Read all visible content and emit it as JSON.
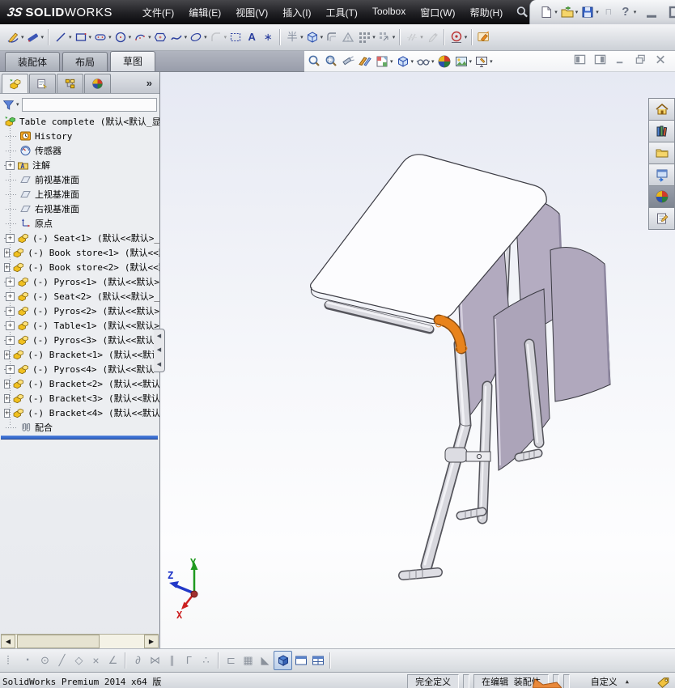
{
  "titlebar": {
    "brand": {
      "mark": "3S",
      "bold": "SOLID",
      "light": "WORKS"
    },
    "menus": [
      "文件(F)",
      "编辑(E)",
      "视图(V)",
      "插入(I)",
      "工具(T)",
      "Toolbox",
      "窗口(W)",
      "帮助(H)"
    ],
    "quick_icons": [
      {
        "name": "new-document",
        "dd": true
      },
      {
        "name": "open-document",
        "dd": true
      },
      {
        "name": "save-document",
        "dd": true
      },
      {
        "name": "rebuild",
        "disabled": true
      },
      {
        "name": "help",
        "dd": true
      }
    ],
    "window_controls": [
      "minimize",
      "maximize",
      "close"
    ]
  },
  "sketch_toolbar": [
    {
      "name": "sketch",
      "dd": true
    },
    {
      "name": "smart-dimension",
      "dd": true
    },
    {
      "sep": true
    },
    {
      "name": "line",
      "dd": true
    },
    {
      "name": "corner-rectangle",
      "dd": true
    },
    {
      "name": "straight-slot",
      "dd": true
    },
    {
      "name": "circle",
      "dd": true
    },
    {
      "name": "centerpoint-arc",
      "dd": true
    },
    {
      "name": "polygon"
    },
    {
      "name": "spline",
      "dd": true
    },
    {
      "name": "ellipse",
      "dd": true
    },
    {
      "name": "sketch-fillet",
      "dd": true,
      "disabled": true
    },
    {
      "name": "selection-box"
    },
    {
      "name": "text"
    },
    {
      "name": "point"
    },
    {
      "sep": true
    },
    {
      "name": "trim-entities",
      "dd": true
    },
    {
      "name": "convert-entities",
      "dd": true
    },
    {
      "name": "offset-entities"
    },
    {
      "name": "mirror-entities"
    },
    {
      "name": "linear-sketch-pattern",
      "dd": true
    },
    {
      "name": "move-entities",
      "dd": true
    },
    {
      "sep": true
    },
    {
      "name": "display-relations",
      "dd": true,
      "disabled": true
    },
    {
      "name": "add-relation",
      "disabled": true
    },
    {
      "sep": true
    },
    {
      "name": "instant2d",
      "dd": true
    },
    {
      "sep": true
    },
    {
      "name": "sketch-tools"
    }
  ],
  "command_tabs": [
    {
      "label": "装配体",
      "active": false
    },
    {
      "label": "布局",
      "active": false
    },
    {
      "label": "草图",
      "active": true
    }
  ],
  "hud_toolbar": [
    {
      "name": "zoom-to-fit"
    },
    {
      "name": "zoom-to-area"
    },
    {
      "name": "previous-view"
    },
    {
      "name": "section-view"
    },
    {
      "name": "view-orientation",
      "dd": true
    },
    {
      "name": "display-style",
      "dd": true
    },
    {
      "name": "hide-show-items",
      "dd": true
    },
    {
      "name": "edit-appearance"
    },
    {
      "name": "apply-scene",
      "dd": true
    },
    {
      "name": "view-settings",
      "dd": true
    }
  ],
  "document_controls": [
    "pane-left",
    "pane-right",
    "doc-minimize",
    "doc-restore",
    "doc-close"
  ],
  "feature_panel": {
    "tabs": [
      "featuremanager",
      "propertymanager",
      "configurationmanager",
      "displaymanager"
    ],
    "overflow": "»",
    "filter_icon": "filter",
    "tree": {
      "root": {
        "icon": "assembly-root",
        "label": "Table complete",
        "suffix": "(默认<默认_显"
      },
      "items": [
        {
          "icon": "history",
          "label": "History"
        },
        {
          "icon": "sensors",
          "label": "传感器"
        },
        {
          "icon": "annotations",
          "label": "注解",
          "expand": true
        },
        {
          "icon": "plane",
          "label": "前视基准面"
        },
        {
          "icon": "plane",
          "label": "上视基准面"
        },
        {
          "icon": "plane",
          "label": "右视基准面"
        },
        {
          "icon": "origin",
          "label": "原点"
        },
        {
          "icon": "component",
          "label": "(-) Seat<1>",
          "suffix": "(默认<<默认>_",
          "expand": true
        },
        {
          "icon": "component",
          "label": "(-) Book store<1>",
          "suffix": "(默认<<默",
          "expand": true
        },
        {
          "icon": "component",
          "label": "(-) Book store<2>",
          "suffix": "(默认<<默",
          "expand": true
        },
        {
          "icon": "component",
          "label": "(-) Pyros<1>",
          "suffix": "(默认<<默认>",
          "expand": true
        },
        {
          "icon": "component",
          "label": "(-) Seat<2>",
          "suffix": "(默认<<默认>_",
          "expand": true
        },
        {
          "icon": "component",
          "label": "(-) Pyros<2>",
          "suffix": "(默认<<默认>",
          "expand": true
        },
        {
          "icon": "component",
          "label": "(-) Table<1>",
          "suffix": "(默认<<默认>",
          "expand": true
        },
        {
          "icon": "component",
          "label": "(-) Pyros<3>",
          "suffix": "(默认<<默认>",
          "expand": true
        },
        {
          "icon": "component",
          "label": "(-) Bracket<1>",
          "suffix": "(默认<<默认",
          "expand": true
        },
        {
          "icon": "component",
          "label": "(-) Pyros<4>",
          "suffix": "(默认<<默认>",
          "expand": true
        },
        {
          "icon": "component",
          "label": "(-) Bracket<2>",
          "suffix": "(默认<<默认",
          "expand": true
        },
        {
          "icon": "component",
          "label": "(-) Bracket<3>",
          "suffix": "(默认<<默认",
          "expand": true
        },
        {
          "icon": "component",
          "label": "(-) Bracket<4>",
          "suffix": "(默认<<默认",
          "expand": true
        },
        {
          "icon": "mates",
          "label": "配合"
        }
      ]
    }
  },
  "viewport": {
    "triad": {
      "x": "X",
      "y": "Y",
      "z": "Z"
    }
  },
  "task_pane": [
    {
      "name": "solidworks-resources"
    },
    {
      "name": "design-library"
    },
    {
      "name": "file-explorer"
    },
    {
      "name": "view-palette"
    },
    {
      "name": "appearances-scenes",
      "active": true
    },
    {
      "name": "custom-properties"
    }
  ],
  "quick_snap_toolbar": [
    {
      "name": "drag-handle"
    },
    {
      "name": "point-snap"
    },
    {
      "name": "center-snap"
    },
    {
      "name": "line-snap"
    },
    {
      "name": "quadrant-snap"
    },
    {
      "name": "intersection-snap"
    },
    {
      "name": "angle-snap"
    },
    {
      "sep": true
    },
    {
      "name": "tangent-snap"
    },
    {
      "name": "midpoint-snap"
    },
    {
      "name": "parallel-snap"
    },
    {
      "name": "perpendicular-snap"
    },
    {
      "name": "nearest-snap"
    },
    {
      "sep": true
    },
    {
      "name": "length-snap"
    },
    {
      "name": "grid-snap"
    },
    {
      "name": "half-snap"
    },
    {
      "name": "shaded-with-edges",
      "active": true
    },
    {
      "name": "single-viewport"
    },
    {
      "name": "four-viewport"
    },
    {
      "sep": true
    }
  ],
  "statusbar": {
    "left": "SolidWorks Premium 2014 x64 版",
    "fully_defined": "完全定义",
    "editing": "在编辑 装配体",
    "custom": "自定义"
  }
}
